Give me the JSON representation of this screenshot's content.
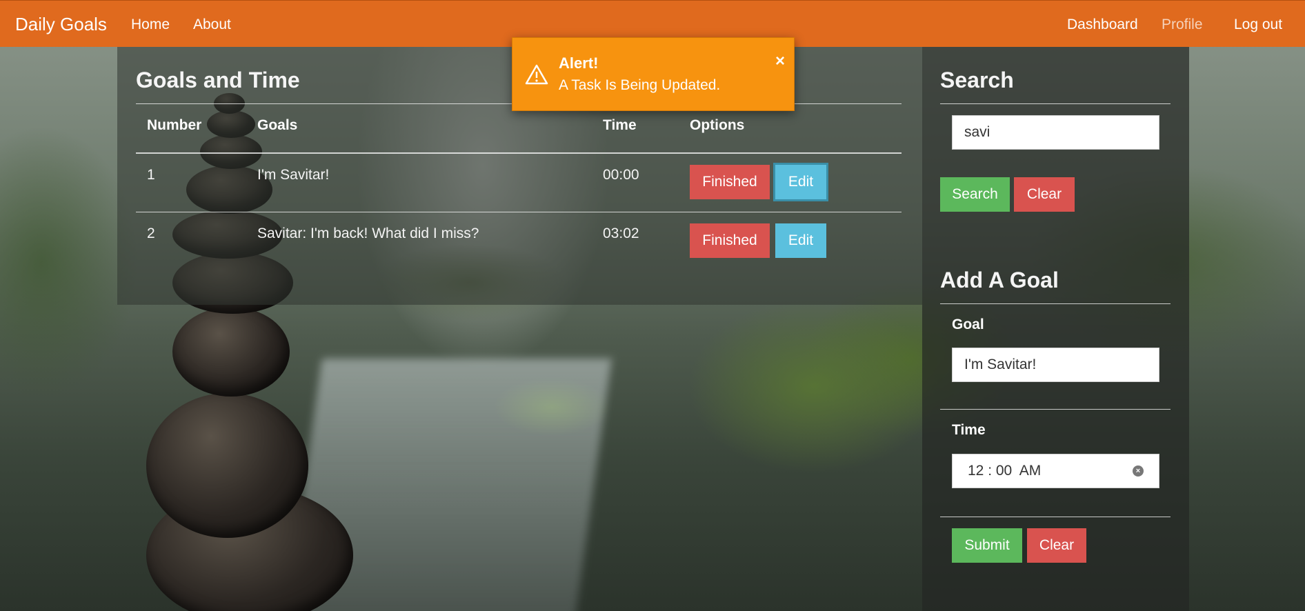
{
  "navbar": {
    "brand": "Daily Goals",
    "links_left": [
      "Home",
      "About"
    ],
    "links_right": [
      "Dashboard",
      "Profile",
      "Log out"
    ]
  },
  "goals_panel": {
    "title": "Goals and Time",
    "columns": [
      "Number",
      "Goals",
      "Time",
      "Options"
    ],
    "rows": [
      {
        "number": "1",
        "goal": "I'm Savitar!",
        "time": "00:00",
        "finished_label": "Finished",
        "edit_label": "Edit"
      },
      {
        "number": "2",
        "goal": "Savitar: I'm back! What did I miss?",
        "time": "03:02",
        "finished_label": "Finished",
        "edit_label": "Edit"
      }
    ]
  },
  "search": {
    "title": "Search",
    "value": "savi",
    "search_label": "Search",
    "clear_label": "Clear"
  },
  "add_goal": {
    "title": "Add A Goal",
    "goal_label": "Goal",
    "goal_value": "I'm Savitar!",
    "time_label": "Time",
    "time_value": "12 : 00  AM",
    "submit_label": "Submit",
    "clear_label": "Clear"
  },
  "alert": {
    "title": "Alert!",
    "message": "A Task Is Being Updated.",
    "close": "×",
    "icon": "warning-triangle-icon"
  },
  "colors": {
    "navbar": "#e06a1e",
    "alert": "#f7930f",
    "danger": "#d9534f",
    "info": "#5bc0de",
    "success": "#5cb85c"
  }
}
